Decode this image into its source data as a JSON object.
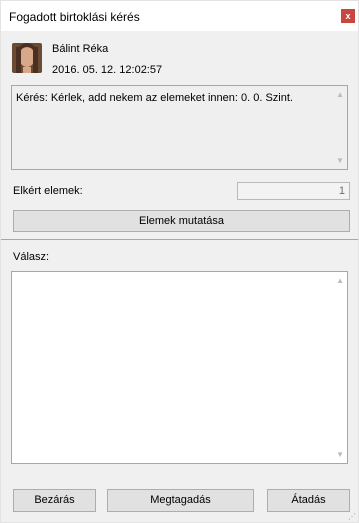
{
  "window": {
    "title": "Fogadott birtoklási kérés",
    "close_symbol": "x"
  },
  "sender": {
    "name": "Bálint Réka",
    "timestamp": "2016. 05. 12. 12:02:57"
  },
  "message": {
    "text": "Kérés: Kérlek, add nekem az elemeket innen: 0. 0. Szint."
  },
  "items": {
    "label": "Elkért elemek:",
    "count": "1"
  },
  "buttons": {
    "show_items": "Elemek mutatása",
    "close": "Bezárás",
    "reject": "Megtagadás",
    "transfer": "Átadás"
  },
  "reply": {
    "label": "Válasz:",
    "value": ""
  },
  "colors": {
    "close_button": "#c8463d",
    "window_bg": "#f0f0f0",
    "button_bg": "#e1e1e1"
  }
}
